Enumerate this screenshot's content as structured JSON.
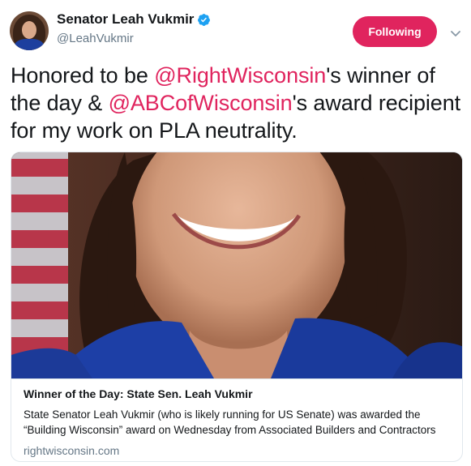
{
  "author": {
    "display_name": "Senator Leah Vukmir",
    "handle": "@LeahVukmir",
    "verified": true
  },
  "follow_button": {
    "label": "Following"
  },
  "tweet": {
    "text_parts": {
      "part1": "Honored to be ",
      "mention1": "@RightWisconsin",
      "part2": "'s winner of the day & ",
      "mention2": "@ABCofWisconsin",
      "part3": "'s award recipient for my work on PLA neutrality."
    }
  },
  "card": {
    "title": "Winner of the Day: State Sen. Leah Vukmir",
    "description": "State Senator Leah Vukmir (who is likely running for US Senate) was awarded the “Building Wisconsin” award on Wednesday from Associated Builders and Contractors",
    "domain": "rightwisconsin.com"
  },
  "icons": {
    "verified": "verified-badge-icon",
    "caret": "chevron-down-icon"
  },
  "colors": {
    "accent": "#e0245e",
    "verified_blue": "#1da1f2",
    "secondary_text": "#657786",
    "border": "#e1e8ed"
  }
}
